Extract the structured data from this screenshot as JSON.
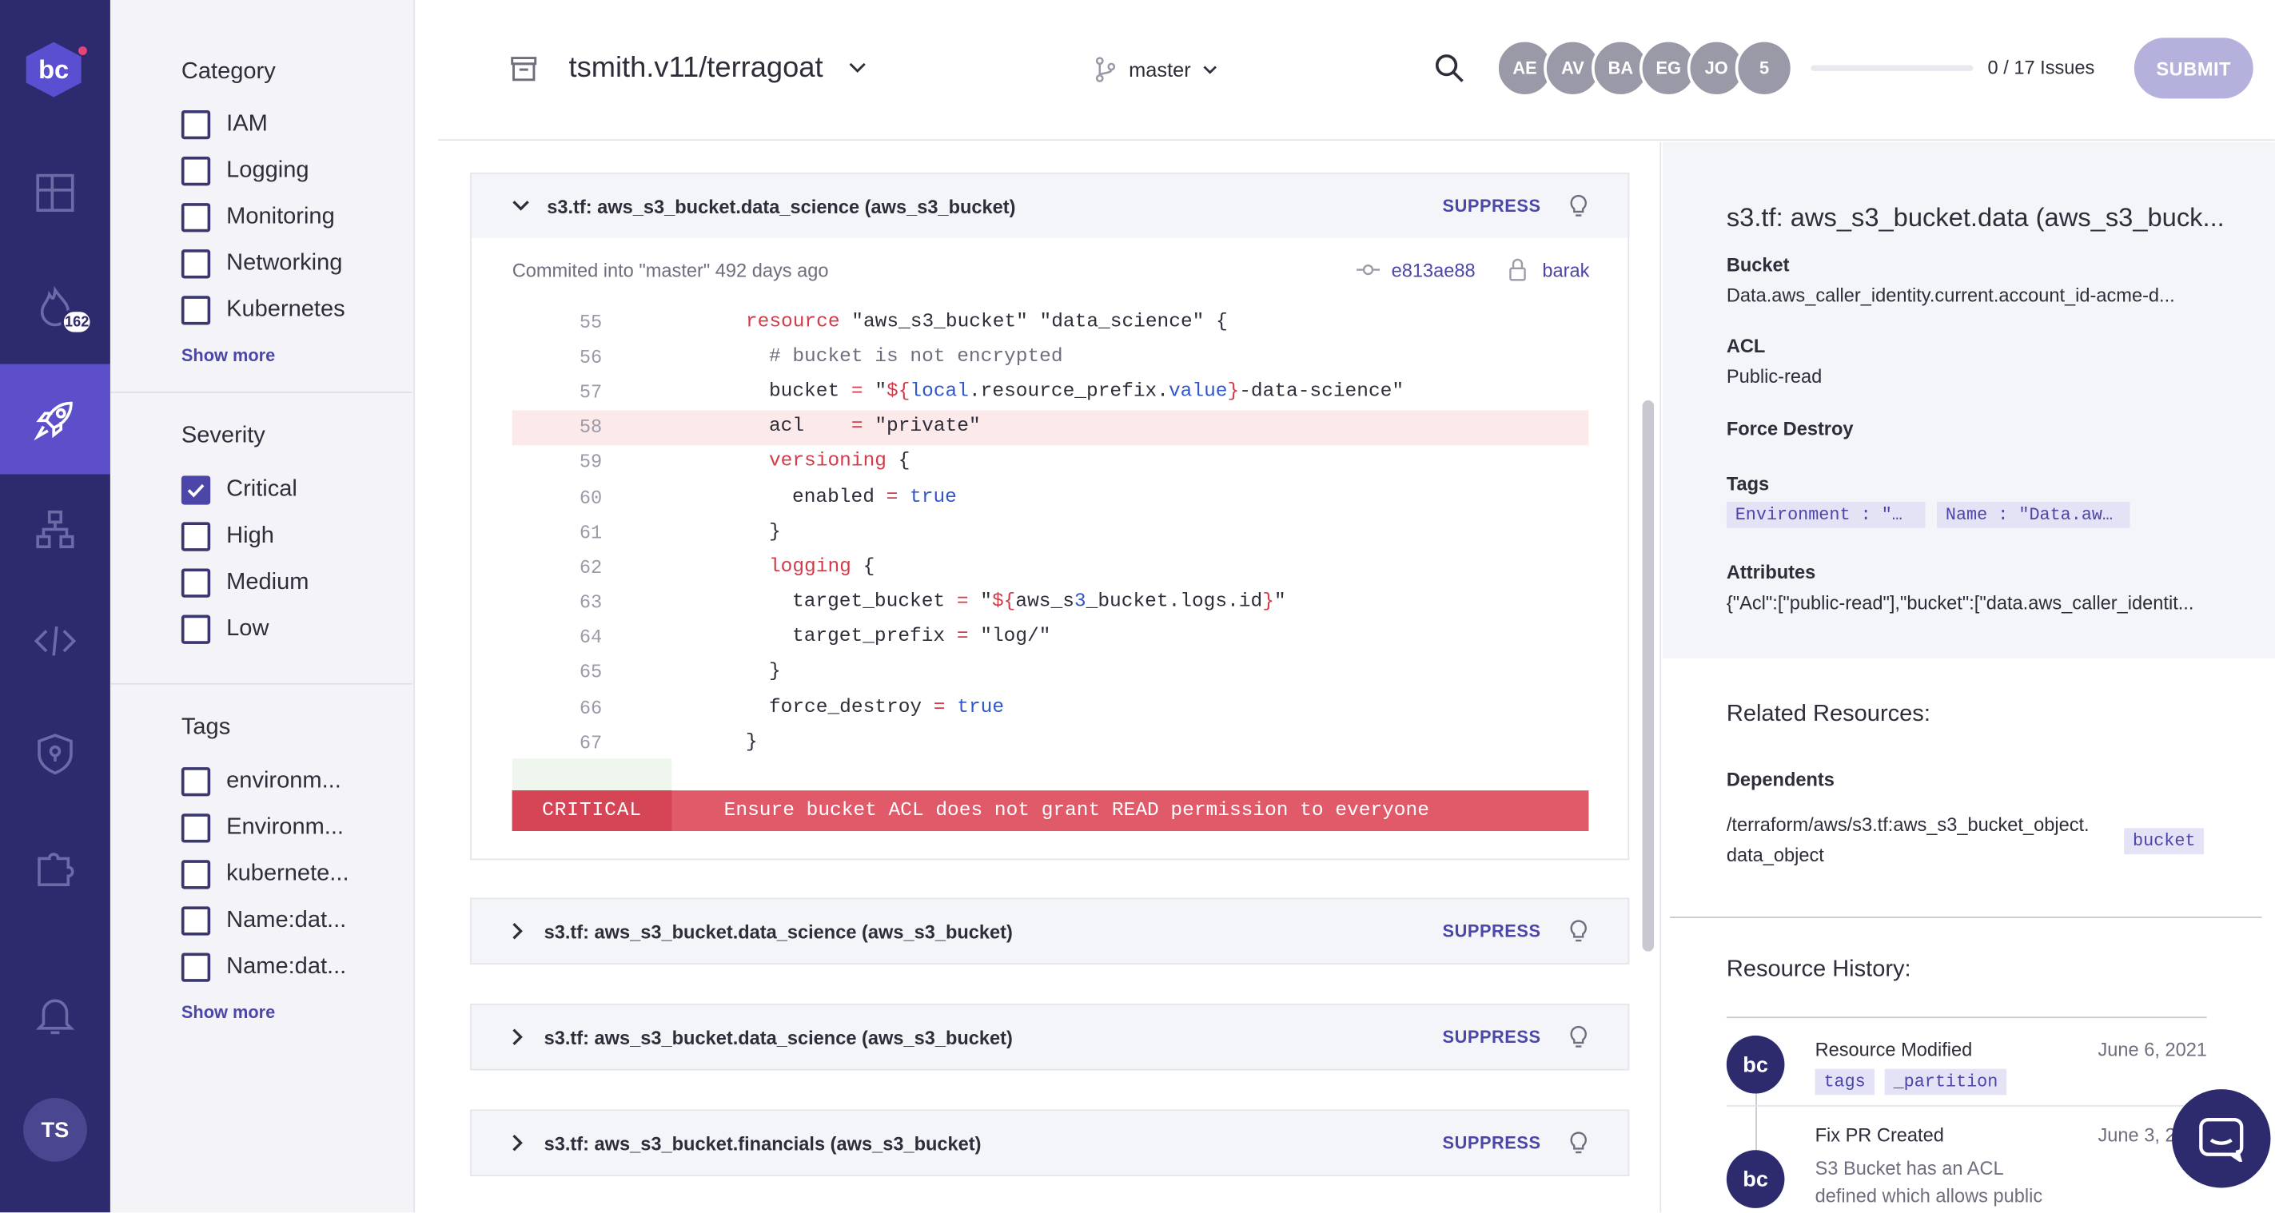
{
  "nav": {
    "logo": "bc",
    "items": [
      {
        "icon": "dashboard-icon"
      },
      {
        "icon": "flame-icon",
        "badge": "162"
      },
      {
        "icon": "rocket-icon",
        "active": true
      },
      {
        "icon": "network-icon"
      },
      {
        "icon": "code-icon"
      },
      {
        "icon": "shield-icon"
      },
      {
        "icon": "puzzle-icon"
      },
      {
        "icon": "bell-icon"
      }
    ],
    "user_initials": "TS"
  },
  "filters": {
    "category": {
      "title": "Category",
      "items": [
        "IAM",
        "Logging",
        "Monitoring",
        "Networking",
        "Kubernetes"
      ],
      "show_more": "Show more"
    },
    "severity": {
      "title": "Severity",
      "items": [
        "Critical",
        "High",
        "Medium",
        "Low"
      ],
      "checked": [
        "Critical"
      ]
    },
    "tags": {
      "title": "Tags",
      "items": [
        "environm...",
        "Environm...",
        "kubernete...",
        "Name:dat...",
        "Name:dat..."
      ],
      "show_more": "Show more"
    }
  },
  "header": {
    "repo": "tsmith.v11/terragoat",
    "branch": "master",
    "avatars": [
      "AE",
      "AV",
      "BA",
      "EG",
      "JO",
      "5"
    ],
    "issues": "0 / 17 Issues",
    "issues_progress": 0,
    "submit": "SUBMIT"
  },
  "cards": [
    {
      "title": "s3.tf: aws_s3_bucket.data_science (aws_s3_bucket)",
      "suppress": "SUPPRESS",
      "expanded": true
    },
    {
      "title": "s3.tf: aws_s3_bucket.data_science (aws_s3_bucket)",
      "suppress": "SUPPRESS"
    },
    {
      "title": "s3.tf: aws_s3_bucket.data_science (aws_s3_bucket)",
      "suppress": "SUPPRESS"
    },
    {
      "title": "s3.tf: aws_s3_bucket.financials (aws_s3_bucket)",
      "suppress": "SUPPRESS"
    }
  ],
  "expanded": {
    "commit": "Commited into \"master\" 492 days ago",
    "hash": "e813ae88",
    "author": "barak",
    "lines": [
      {
        "n": "55"
      },
      {
        "n": "56"
      },
      {
        "n": "57"
      },
      {
        "n": "58"
      },
      {
        "n": "59"
      },
      {
        "n": "60"
      },
      {
        "n": "61"
      },
      {
        "n": "62"
      },
      {
        "n": "63"
      },
      {
        "n": "64"
      },
      {
        "n": "65"
      },
      {
        "n": "66"
      },
      {
        "n": "67"
      }
    ],
    "severity": "CRITICAL",
    "message": "Ensure bucket ACL does not grant READ permission to everyone"
  },
  "details": {
    "title": "s3.tf: aws_s3_bucket.data (aws_s3_buck...",
    "bucket_label": "Bucket",
    "bucket_value": "Data.aws_caller_identity.current.account_id-acme-d...",
    "acl_label": "ACL",
    "acl_value": "Public-read",
    "force_destroy_label": "Force Destroy",
    "tags_label": "Tags",
    "tag1": "Environment : \"…",
    "tag2": "Name : \"Data.aw…",
    "attributes_label": "Attributes",
    "attributes_value": "{\"Acl\":[\"public-read\"],\"bucket\":[\"data.aws_caller_identit...",
    "related_title": "Related Resources:",
    "dependents_label": "Dependents",
    "dependent_path_1": "/terraform/aws/s3.tf:aws_s3_bucket_object.",
    "dependent_path_2": "data_object",
    "dependent_tag": "bucket",
    "history_title": "Resource History:",
    "history": [
      {
        "title": "Resource Modified",
        "date": "June 6, 2021",
        "tags": [
          "tags",
          "_partition"
        ]
      },
      {
        "title": "Fix PR Created",
        "date": "June 3, 2",
        "desc1": "S3 Bucket has an ACL",
        "desc2": "defined which allows public"
      }
    ]
  }
}
